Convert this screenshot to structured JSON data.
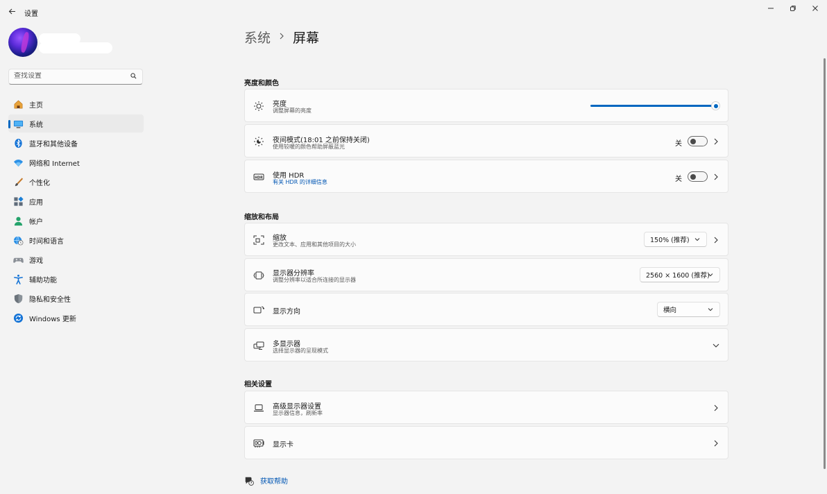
{
  "window": {
    "title": "设置",
    "controls": [
      "minimize",
      "maximize",
      "close"
    ]
  },
  "search": {
    "placeholder": "查找设置"
  },
  "sidebar": {
    "items": [
      {
        "label": "主页",
        "icon": "home-icon"
      },
      {
        "label": "系统",
        "icon": "system-icon",
        "active": true
      },
      {
        "label": "蓝牙和其他设备",
        "icon": "bluetooth-icon"
      },
      {
        "label": "网络和 Internet",
        "icon": "wifi-icon"
      },
      {
        "label": "个性化",
        "icon": "brush-icon"
      },
      {
        "label": "应用",
        "icon": "apps-icon"
      },
      {
        "label": "帐户",
        "icon": "account-icon"
      },
      {
        "label": "时间和语言",
        "icon": "globe-clock-icon"
      },
      {
        "label": "游戏",
        "icon": "gamepad-icon"
      },
      {
        "label": "辅助功能",
        "icon": "accessibility-icon"
      },
      {
        "label": "隐私和安全性",
        "icon": "shield-icon"
      },
      {
        "label": "Windows 更新",
        "icon": "update-icon"
      }
    ]
  },
  "breadcrumb": {
    "parent": "系统",
    "current": "屏幕"
  },
  "sections": {
    "brightness_color": "亮度和颜色",
    "scale_layout": "缩放和布局",
    "related": "相关设置"
  },
  "brightness": {
    "title": "亮度",
    "subtitle": "调整屏幕的亮度",
    "value_percent": 100
  },
  "night_light": {
    "title": "夜间模式(18:01 之前保持关闭)",
    "subtitle": "使用较暖的颜色帮助屏蔽蓝光",
    "state": "关"
  },
  "hdr": {
    "title": "使用 HDR",
    "subtitle": "有关 HDR 的详细信息",
    "state": "关"
  },
  "scale": {
    "title": "缩放",
    "subtitle": "更改文本、应用和其他项目的大小",
    "value": "150% (推荐)"
  },
  "resolution": {
    "title": "显示器分辨率",
    "subtitle": "调整分辨率以适合所连接的显示器",
    "value": "2560 × 1600 (推荐)"
  },
  "orientation": {
    "title": "显示方向",
    "value": "横向"
  },
  "multi_display": {
    "title": "多显示器",
    "subtitle": "选择显示器的呈现模式"
  },
  "advanced_display": {
    "title": "高级显示器设置",
    "subtitle": "显示器信息，刷新率"
  },
  "graphics": {
    "title": "显示卡"
  },
  "help": {
    "label": "获取帮助"
  },
  "accent_color": "#0067c0"
}
